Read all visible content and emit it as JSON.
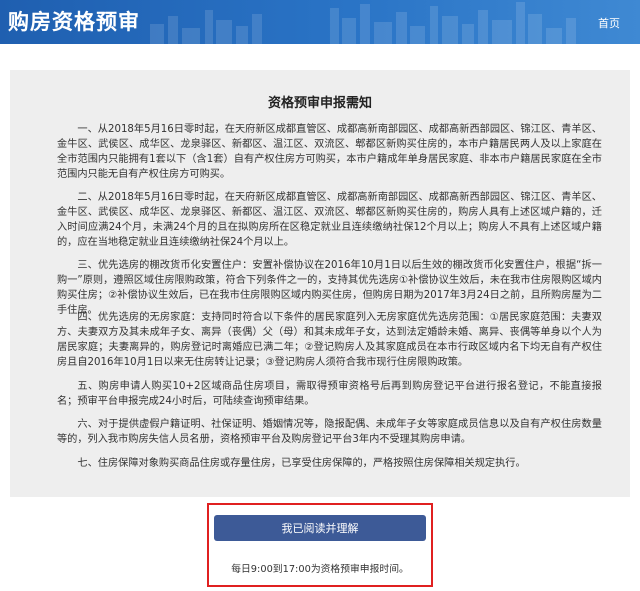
{
  "header": {
    "title": "购房资格预审",
    "home_link": "首页"
  },
  "notice": {
    "title": "资格预审申报需知",
    "paragraphs": [
      "一、从2018年5月16日零时起，在天府新区成都直管区、成都高新南部园区、成都高新西部园区、锦江区、青羊区、金牛区、武侯区、成华区、龙泉驿区、新都区、温江区、双流区、郫都区新购买住房的，本市户籍居民两人及以上家庭在全市范围内只能拥有1套以下（含1套）自有产权住房方可购买，本市户籍成年单身居民家庭、非本市户籍居民家庭在全市范围内只能无自有产权住房方可购买。",
      "二、从2018年5月16日零时起，在天府新区成都直管区、成都高新南部园区、成都高新西部园区、锦江区、青羊区、金牛区、武侯区、成华区、龙泉驿区、新都区、温江区、双流区、郫都区新购买住房的，购房人具有上述区域户籍的，迁入时间应满24个月，未满24个月的且在拟购房所在区稳定就业且连续缴纳社保12个月以上；购房人不具有上述区域户籍的，应在当地稳定就业且连续缴纳社保24个月以上。",
      "三、优先选房的棚改货币化安置住户：安置补偿协议在2016年10月1日以后生效的棚改货币化安置住户，根据“拆一购一”原则，遵照区域住房限购政策，符合下列条件之一的，支持其优先选房①补偿协议生效后，未在我市住房限购区域内购买住房；②补偿协议生效后，已在我市住房限购区域内购买住房，但购房日期为2017年3月24日之前，且所购房屋为二手住房。",
      "四、优先选房的无房家庭：支持同时符合以下条件的居民家庭列入无房家庭优先选房范围：①居民家庭范围：夫妻双方、夫妻双方及其未成年子女、离异（丧偶）父（母）和其未成年子女，达到法定婚龄未婚、离异、丧偶等单身以个人为居民家庭；夫妻离异的，购房登记时离婚应已满二年；②登记购房人及其家庭成员在本市行政区域内名下均无自有产权住房且自2016年10月1日以来无住房转让记录；③登记购房人须符合我市现行住房限购政策。",
      "五、购房申请人购买10+2区域商品住房项目，需取得预审资格号后再到购房登记平台进行报名登记，不能直接报名；预审平台申报完成24小时后，可陆续查询预审结果。",
      "六、对于提供虚假户籍证明、社保证明、婚姻情况等，隐报配偶、未成年子女等家庭成员信息以及自有产权住房数量等的，列入我市购房失信人员名册，资格预审平台及购房登记平台3年内不受理其购房申请。",
      "七、住房保障对象购买商品住房或存量住房，已享受住房保障的，严格按照住房保障相关规定执行。"
    ]
  },
  "action": {
    "agree_label": "我已阅读并理解",
    "time_note": "每日9:00到17:00为资格预审申报时间。"
  },
  "colors": {
    "header_blue": "#2a74c6",
    "button_blue": "#3d5a97",
    "highlight_red": "#e02020",
    "notice_bg": "#eeeeee"
  }
}
